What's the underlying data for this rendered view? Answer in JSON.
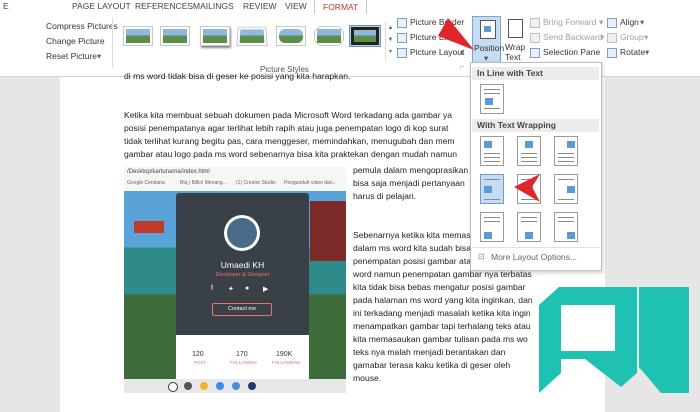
{
  "tabs": [
    "E",
    "PAGE LAYOUT",
    "REFERENCES",
    "MAILINGS",
    "REVIEW",
    "VIEW",
    "FORMAT"
  ],
  "adjust": [
    "Compress Pictures",
    "Change Picture",
    "Reset Picture"
  ],
  "picture_styles_label": "Picture Styles",
  "picture_group": {
    "border": "Picture Border",
    "effects": "Picture Eff",
    "layout": "Picture Layout"
  },
  "position_label": "Position",
  "wrap_label": "Wrap\nText",
  "arrange": {
    "bring_forward": "Bring Forward",
    "send_backward": "Send Backward",
    "selection_pane": "Selection Pane",
    "align": "Align",
    "group": "Group",
    "rotate": "Rotate"
  },
  "document": {
    "top_line": "di ms word tidak bisa di geser ke posisi yang kita harapkan.",
    "para1": [
      "Ketika kita membuat sebuah dokumen pada Microsoft Word terkadang ada gambar ya",
      "posisi penempatanya agar terlihat lebih rapih atau juga penempatan logo di kop surat",
      "tidak terlihat kurang begitu pas, cara menggeser, memindahkan, menugubah dan mem",
      "gambar atau logo pada ms word sebenarnya bisa kita praktekan dengan mudah namun"
    ],
    "para1_right": [
      "pemula dalam mengoprasikan",
      "bisa saja menjadi pertanyaan",
      "harus di pelajari."
    ],
    "para2": [
      "Sebenarnya ketika kita memasu",
      "dalam ms word kita sudah bisa",
      "penempatan posisi gambar atau",
      "word namun penempatan gambar nya terbatas",
      "kita tidak bisa bebas mengatur posisi gambar",
      "pada halaman ms word yang kita inginkan, dan",
      "ini terkadang menjadi masalah ketika kita ingin",
      "menampatkan gambar tapi terhalang teks atau",
      "kita memasaukan gambar tulisan pada ms wo",
      "teks nya malah menjadi berantakan dan",
      "gamabar terasa kaku ketika di geser oleh",
      "mouse."
    ]
  },
  "screenshot": {
    "url": "/Desktop/kartunama/index.html",
    "bookmarks": [
      "Google Cendana",
      "Btq | Billini Menang...",
      "(1) Creator Studio",
      "Pengunduh video dan..."
    ],
    "name": "Umaedi KH",
    "role": "Developer & Designer",
    "contact": "Contact me",
    "stats": [
      {
        "value": "120",
        "label": "POST"
      },
      {
        "value": "170",
        "label": "FOLLOWING"
      },
      {
        "value": "190K",
        "label": "FOLLOWERS"
      }
    ]
  },
  "dropdown": {
    "inline_header": "In Line with Text",
    "wrap_header": "With Text Wrapping",
    "more": "More Layout Options..."
  },
  "colors": {
    "format_tab": "#c4392b",
    "arrow": "#e0262a",
    "logo": "#1fc2b2",
    "highlight": "#c6dcf2"
  }
}
